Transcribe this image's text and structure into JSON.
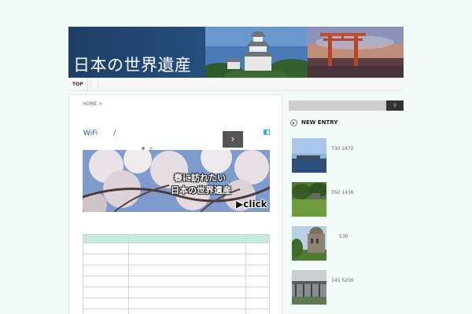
{
  "header": {
    "site_title": "日本の世界遺産"
  },
  "nav": {
    "items": [
      {
        "label": "TOP"
      }
    ]
  },
  "breadcrumb": {
    "home": "HOME",
    "separator": ">"
  },
  "ad": {
    "wifi_text": "WiFi",
    "wifi_slash": "/",
    "next_icon": "chevron-right-icon",
    "banner_line1": "春に訪れたい",
    "banner_line2": "日本の世界遺産",
    "banner_click": "▶click"
  },
  "sidebar": {
    "search_placeholder": "",
    "search_icon": "search-icon",
    "new_entry_heading": "NEW ENTRY",
    "entries": [
      {
        "meta": "730 2472"
      },
      {
        "meta": "350 1416"
      },
      {
        "meta": "530"
      },
      {
        "meta": "145 5200"
      }
    ]
  },
  "colors": {
    "banner_dark": "#1d3f66",
    "table_header": "#c8eadb",
    "page_bg": "#f2fbf8",
    "search_button": "#333333"
  }
}
